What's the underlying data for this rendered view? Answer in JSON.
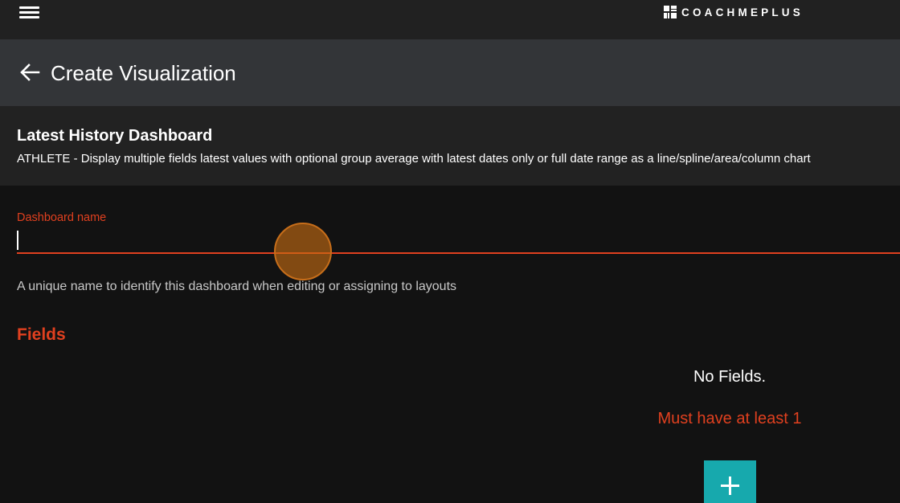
{
  "topbar": {
    "menu_icon": "hamburger-menu-icon",
    "brand_icon": "coachmeplus-logo-mark",
    "brand_text": "COACHMEPLUS"
  },
  "header": {
    "back_icon": "arrow-left-icon",
    "title": "Create Visualization"
  },
  "info": {
    "title": "Latest History Dashboard",
    "description": "ATHLETE - Display multiple fields latest values with optional group average with latest dates only or full date range as a line/spline/area/column chart"
  },
  "form": {
    "name_label": "Dashboard name",
    "name_value": "",
    "name_hint": "A unique name to identify this dashboard when editing or assigning to layouts"
  },
  "fields": {
    "heading": "Fields",
    "empty_text": "No Fields.",
    "validation_text": "Must have at least 1",
    "add_icon": "plus-icon"
  },
  "colors": {
    "accent_error": "#e0401f",
    "add_button": "#17a9ad",
    "topbar": "#212121",
    "header": "#333538",
    "info": "#222222",
    "background": "#121212"
  }
}
